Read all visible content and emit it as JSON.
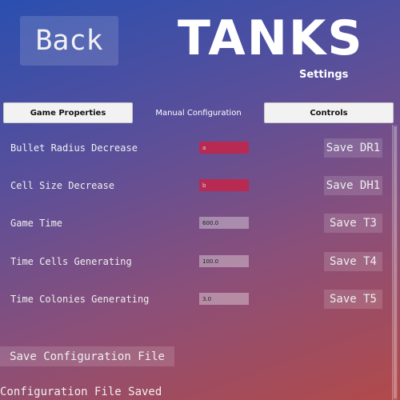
{
  "header": {
    "back_label": "Back",
    "title": "TANKS",
    "subtitle": "Settings"
  },
  "tabs": [
    {
      "label": "Game Properties",
      "active": false
    },
    {
      "label": "Manual Configuration",
      "active": true
    },
    {
      "label": "Controls",
      "active": false
    }
  ],
  "settings": [
    {
      "label": "Bullet Radius Decrease",
      "value": "a",
      "save_label": "Save DR1",
      "invalid": true
    },
    {
      "label": "Cell Size Decrease",
      "value": "b",
      "save_label": "Save DH1",
      "invalid": true
    },
    {
      "label": "Game Time",
      "value": "600.0",
      "save_label": "Save T3",
      "invalid": false
    },
    {
      "label": "Time Cells Generating",
      "value": "100.0",
      "save_label": "Save T4",
      "invalid": false
    },
    {
      "label": "Time Colonies Generating",
      "value": "3.0",
      "save_label": "Save T5",
      "invalid": false
    }
  ],
  "footer": {
    "save_config_label": "Save Configuration File",
    "status_text": "Configuration File Saved"
  },
  "colors": {
    "invalid_input": "#b82a52",
    "tab_bg": "#f2f2f2"
  }
}
